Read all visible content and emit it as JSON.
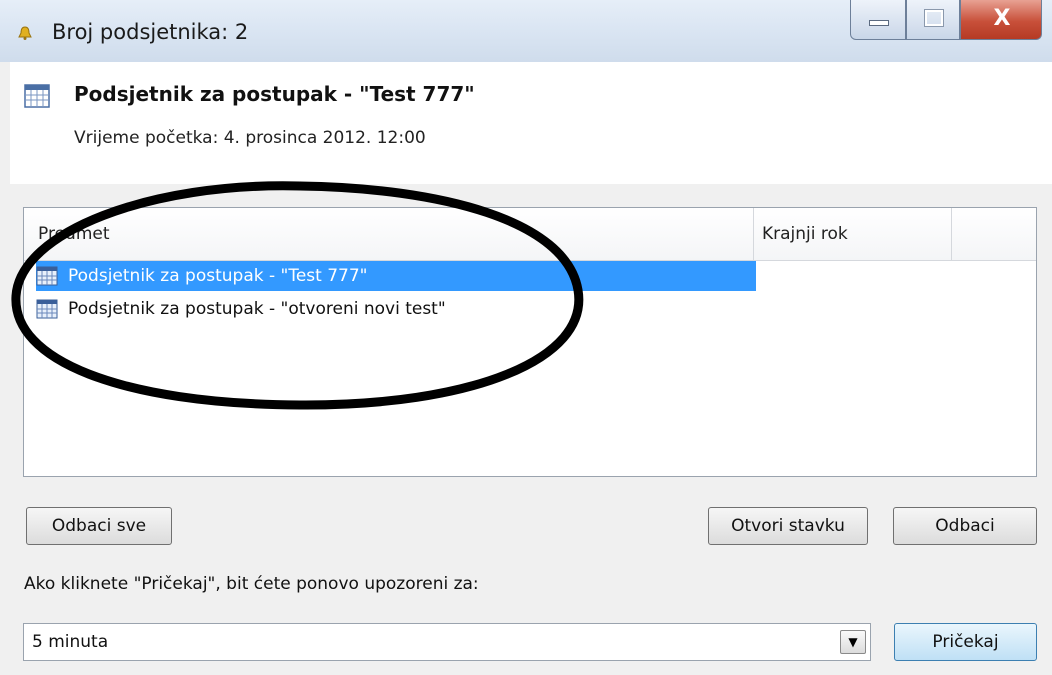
{
  "window": {
    "title": "Broj podsjetnika: 2",
    "close_glyph": "X"
  },
  "header": {
    "title": "Podsjetnik za postupak - \"Test 777\"",
    "start_time": "Vrijeme početka: 4. prosinca 2012. 12:00",
    "icon": "calendar-icon"
  },
  "list": {
    "columns": [
      "Predmet",
      "Krajnji rok",
      ""
    ],
    "rows": [
      {
        "subject": "Podsjetnik za postupak - \"Test 777\"",
        "due": "",
        "selected": true
      },
      {
        "subject": "Podsjetnik za postupak - \"otvoreni novi test\"",
        "due": "",
        "selected": false
      }
    ]
  },
  "buttons": {
    "dismiss_all": "Odbaci sve",
    "open_item": "Otvori stavku",
    "dismiss": "Odbaci",
    "snooze": "Pričekaj"
  },
  "snooze": {
    "label": "Ako kliknete \"Pričekaj\", bit ćete ponovo upozoreni za:",
    "selected": "5 minuta"
  },
  "colors": {
    "selection": "#3399ff",
    "annotation": "#000000"
  }
}
